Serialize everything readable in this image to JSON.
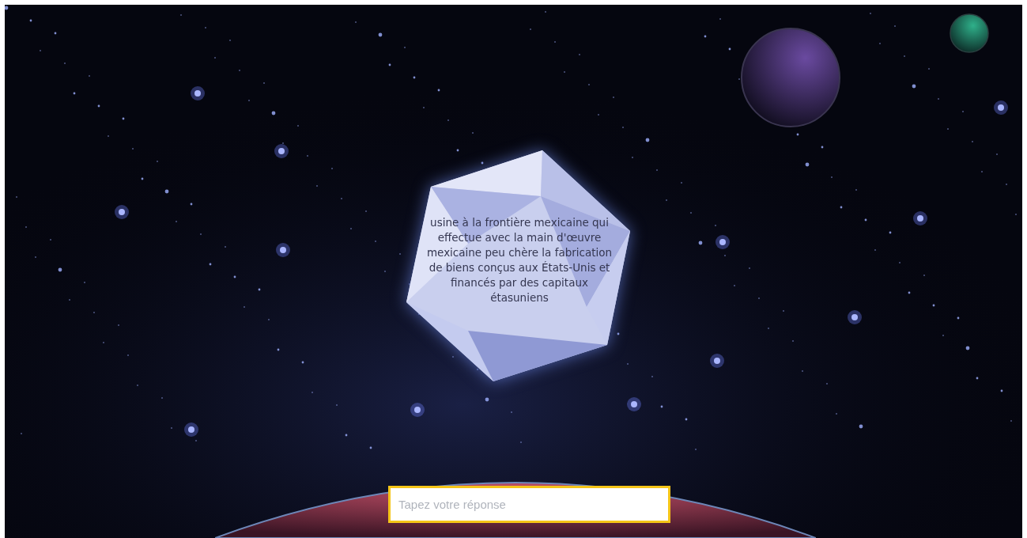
{
  "asteroid": {
    "prompt": "usine à la frontière mexicaine qui effectue avec la main d'œuvre mexicaine peu chère la fabrication de biens conçus aux États-Unis et financés par des capitaux étasuniens"
  },
  "answer": {
    "placeholder": "Tapez votre réponse"
  }
}
